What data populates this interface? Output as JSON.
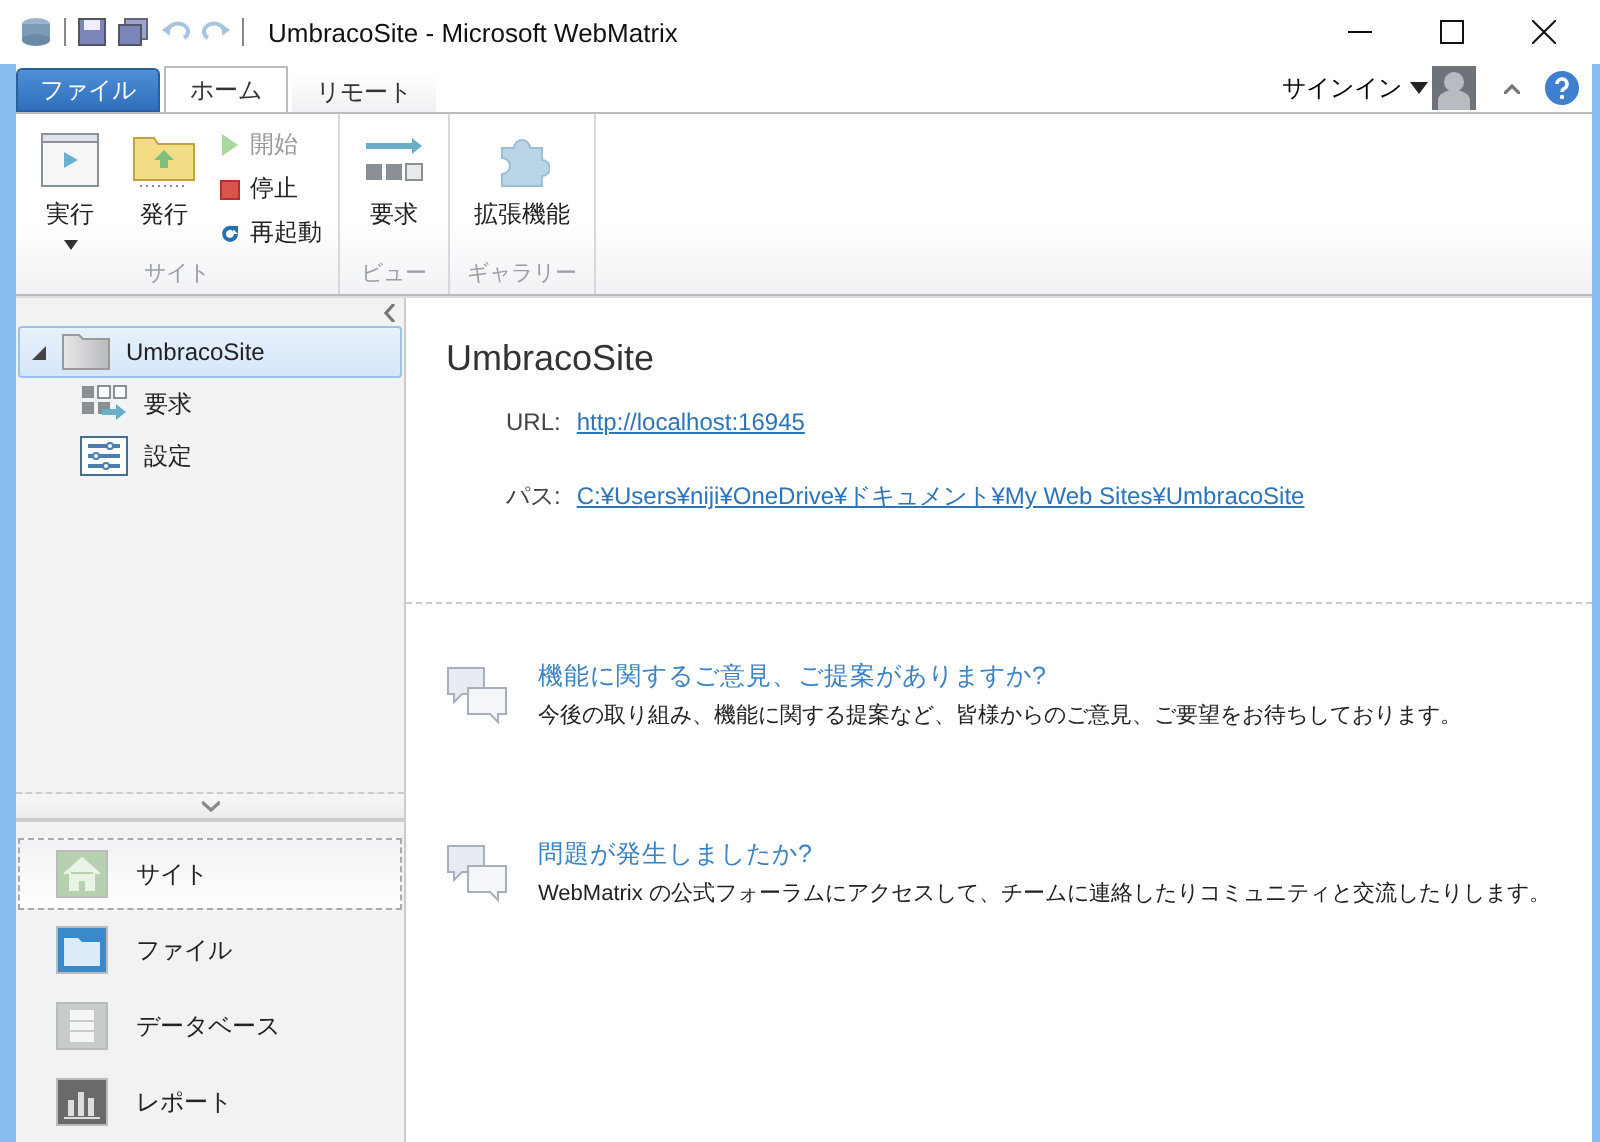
{
  "window": {
    "title": "UmbracoSite - Microsoft WebMatrix"
  },
  "ribbon": {
    "tabs": [
      {
        "label": "ファイル",
        "kind": "file"
      },
      {
        "label": "ホーム",
        "kind": "tab",
        "selected": true
      },
      {
        "label": "リモート",
        "kind": "tab",
        "selected": false
      }
    ],
    "account": {
      "label": "サインイン"
    },
    "groups": [
      {
        "label": "サイト",
        "items": [
          {
            "label": "実行",
            "kind": "large",
            "dropdown": true,
            "disabled": false
          },
          {
            "label": "発行",
            "kind": "large",
            "disabled": false
          },
          {
            "label": "開始",
            "kind": "small",
            "disabled": true
          },
          {
            "label": "停止",
            "kind": "small",
            "disabled": false
          },
          {
            "label": "再起動",
            "kind": "small",
            "disabled": false
          }
        ]
      },
      {
        "label": "ビュー",
        "items": [
          {
            "label": "要求",
            "kind": "large",
            "disabled": false
          }
        ]
      },
      {
        "label": "ギャラリー",
        "items": [
          {
            "label": "拡張機能",
            "kind": "large",
            "disabled": false
          }
        ]
      }
    ]
  },
  "tree": [
    {
      "label": "UmbracoSite",
      "expanded": true,
      "selected": true,
      "children": [
        {
          "label": "要求",
          "selected": false
        },
        {
          "label": "設定",
          "selected": false
        }
      ]
    }
  ],
  "workspaces": [
    {
      "label": "サイト",
      "selected": true
    },
    {
      "label": "ファイル",
      "selected": false
    },
    {
      "label": "データベース",
      "selected": false
    },
    {
      "label": "レポート",
      "selected": false
    }
  ],
  "site": {
    "title": "UmbracoSite",
    "fields": [
      {
        "label": "URL:",
        "value": "http://localhost:16945"
      },
      {
        "label": "パス:",
        "value": "C:¥Users¥niji¥OneDrive¥ドキュメント¥My Web Sites¥UmbracoSite"
      }
    ]
  },
  "feedback": [
    {
      "title": "機能に関するご意見、ご提案がありますか?",
      "text": "今後の取り組み、機能に関する提案など、皆様からのご意見、ご要望をお待ちしております。"
    },
    {
      "title": "問題が発生しましたか?",
      "text": "WebMatrix の公式フォーラムにアクセスして、チームに連絡したりコミュニティと交流したりします。"
    }
  ]
}
